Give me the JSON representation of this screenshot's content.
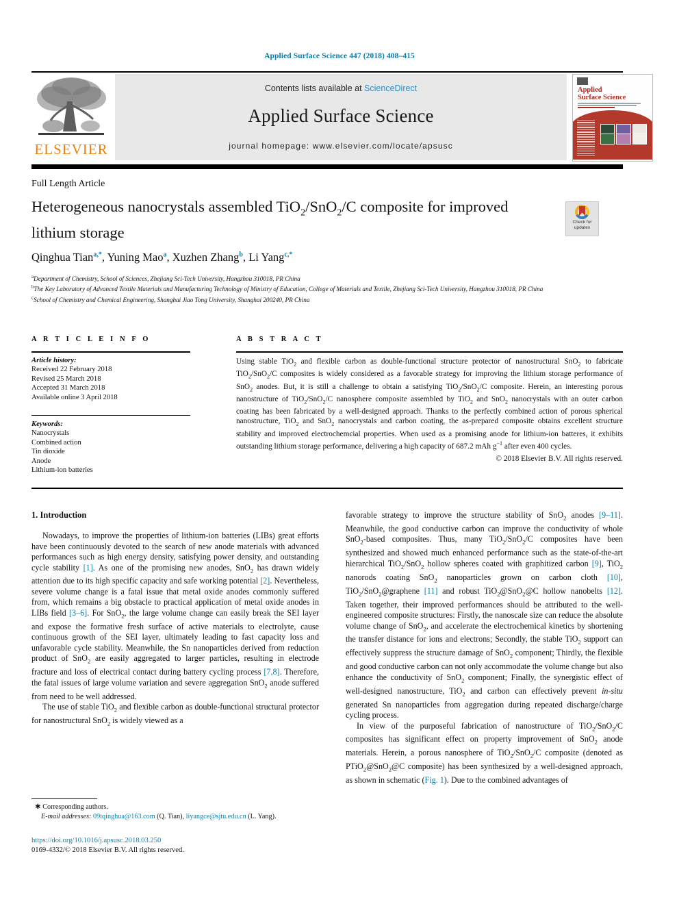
{
  "running_head": "Applied Surface Science 447 (2018) 408–415",
  "masthead": {
    "publisher_name": "ELSEVIER",
    "contents_prefix": "Contents lists available at",
    "contents_link": "ScienceDirect",
    "journal_name": "Applied Surface Science",
    "homepage": "journal homepage: www.elsevier.com/locate/apsusc",
    "cover": {
      "title_line1": "Applied",
      "title_line2": "Surface Science"
    }
  },
  "article": {
    "type": "Full Length Article",
    "title_part1": "Heterogeneous nanocrystals assembled TiO",
    "title_sub1": "2",
    "title_part2": "/SnO",
    "title_sub2": "2",
    "title_part3": "/C composite for improved lithium storage",
    "crossmark_line1": "Check for",
    "crossmark_line2": "updates"
  },
  "authors": {
    "list": "Qinghua Tian, Yuning Mao, Xuzhen Zhang, Li Yang",
    "a1": "Department of Chemistry, School of Sciences, Zhejiang Sci-Tech University, Hangzhou 310018, PR China",
    "a2": "The Key Laboratory of Advanced Textile Materials and Manufacturing Technology of Ministry of Education, College of Materials and Textile, Zhejiang Sci-Tech University, Hangzhou 310018, PR China",
    "a3": "School of Chemistry and Chemical Engineering, Shanghai Jiao Tong University, Shanghai 200240, PR China"
  },
  "article_info": {
    "heading": "A R T I C L E   I N F O",
    "history_label": "Article history:",
    "received": "Received 22 February 2018",
    "revised": "Revised 25 March 2018",
    "accepted": "Accepted 31 March 2018",
    "available": "Available online 3 April 2018",
    "keywords_label": "Keywords:",
    "keywords": [
      "Nanocrystals",
      "Combined action",
      "Tin dioxide",
      "Anode",
      "Lithium-ion batteries"
    ]
  },
  "abstract": {
    "heading": "A B S T R A C T",
    "copyright": "© 2018 Elsevier B.V. All rights reserved."
  },
  "body": {
    "section_heading": "1. Introduction"
  },
  "footnotes": {
    "corresponding": "Corresponding authors.",
    "email_label": "E-mail addresses:",
    "email1": "09tqinghua@163.com",
    "email1_owner": "(Q. Tian),",
    "email2": "liyangce@sjtu.edu.cn",
    "email2_owner": "(L. Yang).",
    "doi": "https://doi.org/10.1016/j.apsusc.2018.03.250",
    "issn": "0169-4332/© 2018 Elsevier B.V. All rights reserved."
  },
  "colors": {
    "link": "#0b7ca8",
    "sciencedirect": "#2b8fc4",
    "elsevier_orange": "#f07f09",
    "cover_red": "#b3392c"
  }
}
